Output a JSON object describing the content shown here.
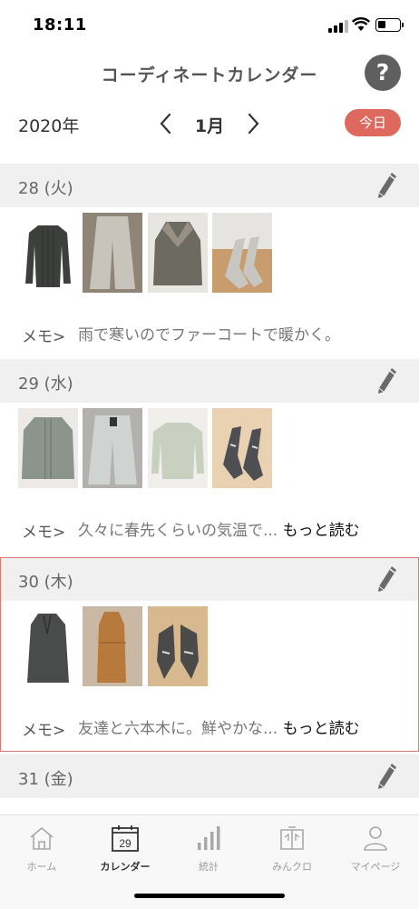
{
  "status_bar": {
    "time": "18:11",
    "battery_level": 0.35
  },
  "header": {
    "title": "コーディネートカレンダー",
    "help_label": "?",
    "year": "2020年",
    "month": "1月",
    "today_label": "今日"
  },
  "memo_label": "メモ>",
  "days": [
    {
      "label": "28 (火)",
      "photos": [
        {
          "item": "black-ribbed-sweater",
          "bg": "#ffffff",
          "color": "#3d3f3c"
        },
        {
          "item": "grey-wide-trousers",
          "bg": "#8f8577",
          "color": "#c9c4bb"
        },
        {
          "item": "fur-coat",
          "bg": "#e8e6e2",
          "color": "#6d6a62"
        },
        {
          "item": "grey-pumps",
          "bg": "#c99c6e",
          "color": "#c8c6c1"
        }
      ],
      "memo": "雨で寒いのでファーコートで暖かく。",
      "read_more": ""
    },
    {
      "label": "29 (水)",
      "photos": [
        {
          "item": "green-cardigan",
          "bg": "#ece9e6",
          "color": "#8b958b"
        },
        {
          "item": "light-wide-pants",
          "bg": "#b3b1ad",
          "color": "#cfd3d2"
        },
        {
          "item": "mint-sweater",
          "bg": "#f0efec",
          "color": "#c9d0bf"
        },
        {
          "item": "snake-pumps",
          "bg": "#e9d1b2",
          "color": "#4e4f52"
        }
      ],
      "memo": "久々に春先くらいの気温で...",
      "read_more": "もっと読む"
    },
    {
      "label": "30 (木)",
      "photos": [
        {
          "item": "long-grey-coat",
          "bg": "#ffffff",
          "color": "#4a4c4b"
        },
        {
          "item": "orange-dress",
          "bg": "#c8b8a4",
          "color": "#b77a3c"
        },
        {
          "item": "snake-pointed-shoes",
          "bg": "#d8b88f",
          "color": "#4a4a4a"
        }
      ],
      "memo": "友達と六本木に。鮮やかな...",
      "read_more": "もっと読む"
    },
    {
      "label": "31 (金)",
      "photos": [],
      "memo": "",
      "read_more": ""
    }
  ],
  "tabs": [
    {
      "label": "ホーム",
      "icon": "home-icon"
    },
    {
      "label": "カレンダー",
      "icon": "calendar-icon",
      "badge": "29",
      "active": true
    },
    {
      "label": "統計",
      "icon": "bar-chart-icon"
    },
    {
      "label": "みんクロ",
      "icon": "closet-icon"
    },
    {
      "label": "マイページ",
      "icon": "person-icon"
    }
  ],
  "colors": {
    "accent": "#de6a5f",
    "selected_border": "#d97a72",
    "section_bg": "#f0f0f0"
  }
}
